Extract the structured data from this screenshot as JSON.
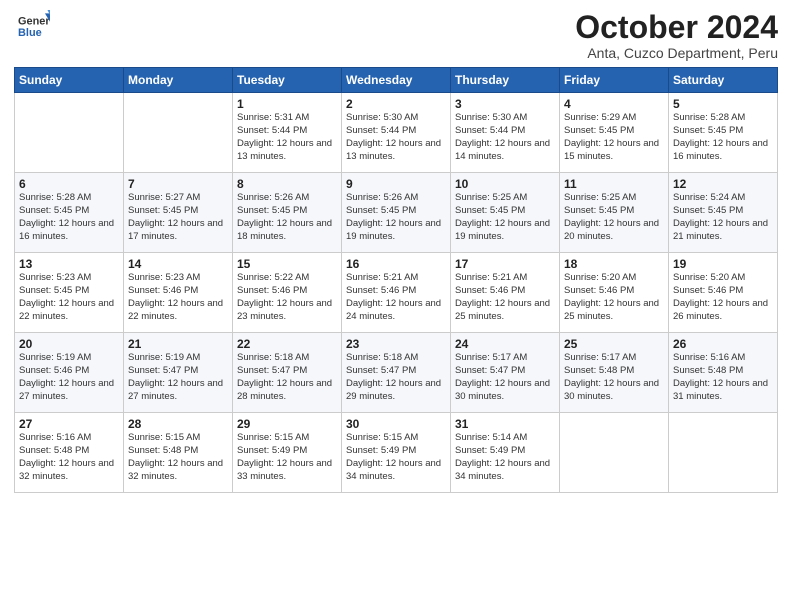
{
  "logo": {
    "general": "General",
    "blue": "Blue"
  },
  "header": {
    "month": "October 2024",
    "location": "Anta, Cuzco Department, Peru"
  },
  "days_of_week": [
    "Sunday",
    "Monday",
    "Tuesday",
    "Wednesday",
    "Thursday",
    "Friday",
    "Saturday"
  ],
  "weeks": [
    [
      {
        "day": "",
        "sunrise": "",
        "sunset": "",
        "daylight": ""
      },
      {
        "day": "",
        "sunrise": "",
        "sunset": "",
        "daylight": ""
      },
      {
        "day": "1",
        "sunrise": "Sunrise: 5:31 AM",
        "sunset": "Sunset: 5:44 PM",
        "daylight": "Daylight: 12 hours and 13 minutes."
      },
      {
        "day": "2",
        "sunrise": "Sunrise: 5:30 AM",
        "sunset": "Sunset: 5:44 PM",
        "daylight": "Daylight: 12 hours and 13 minutes."
      },
      {
        "day": "3",
        "sunrise": "Sunrise: 5:30 AM",
        "sunset": "Sunset: 5:44 PM",
        "daylight": "Daylight: 12 hours and 14 minutes."
      },
      {
        "day": "4",
        "sunrise": "Sunrise: 5:29 AM",
        "sunset": "Sunset: 5:45 PM",
        "daylight": "Daylight: 12 hours and 15 minutes."
      },
      {
        "day": "5",
        "sunrise": "Sunrise: 5:28 AM",
        "sunset": "Sunset: 5:45 PM",
        "daylight": "Daylight: 12 hours and 16 minutes."
      }
    ],
    [
      {
        "day": "6",
        "sunrise": "Sunrise: 5:28 AM",
        "sunset": "Sunset: 5:45 PM",
        "daylight": "Daylight: 12 hours and 16 minutes."
      },
      {
        "day": "7",
        "sunrise": "Sunrise: 5:27 AM",
        "sunset": "Sunset: 5:45 PM",
        "daylight": "Daylight: 12 hours and 17 minutes."
      },
      {
        "day": "8",
        "sunrise": "Sunrise: 5:26 AM",
        "sunset": "Sunset: 5:45 PM",
        "daylight": "Daylight: 12 hours and 18 minutes."
      },
      {
        "day": "9",
        "sunrise": "Sunrise: 5:26 AM",
        "sunset": "Sunset: 5:45 PM",
        "daylight": "Daylight: 12 hours and 19 minutes."
      },
      {
        "day": "10",
        "sunrise": "Sunrise: 5:25 AM",
        "sunset": "Sunset: 5:45 PM",
        "daylight": "Daylight: 12 hours and 19 minutes."
      },
      {
        "day": "11",
        "sunrise": "Sunrise: 5:25 AM",
        "sunset": "Sunset: 5:45 PM",
        "daylight": "Daylight: 12 hours and 20 minutes."
      },
      {
        "day": "12",
        "sunrise": "Sunrise: 5:24 AM",
        "sunset": "Sunset: 5:45 PM",
        "daylight": "Daylight: 12 hours and 21 minutes."
      }
    ],
    [
      {
        "day": "13",
        "sunrise": "Sunrise: 5:23 AM",
        "sunset": "Sunset: 5:45 PM",
        "daylight": "Daylight: 12 hours and 22 minutes."
      },
      {
        "day": "14",
        "sunrise": "Sunrise: 5:23 AM",
        "sunset": "Sunset: 5:46 PM",
        "daylight": "Daylight: 12 hours and 22 minutes."
      },
      {
        "day": "15",
        "sunrise": "Sunrise: 5:22 AM",
        "sunset": "Sunset: 5:46 PM",
        "daylight": "Daylight: 12 hours and 23 minutes."
      },
      {
        "day": "16",
        "sunrise": "Sunrise: 5:21 AM",
        "sunset": "Sunset: 5:46 PM",
        "daylight": "Daylight: 12 hours and 24 minutes."
      },
      {
        "day": "17",
        "sunrise": "Sunrise: 5:21 AM",
        "sunset": "Sunset: 5:46 PM",
        "daylight": "Daylight: 12 hours and 25 minutes."
      },
      {
        "day": "18",
        "sunrise": "Sunrise: 5:20 AM",
        "sunset": "Sunset: 5:46 PM",
        "daylight": "Daylight: 12 hours and 25 minutes."
      },
      {
        "day": "19",
        "sunrise": "Sunrise: 5:20 AM",
        "sunset": "Sunset: 5:46 PM",
        "daylight": "Daylight: 12 hours and 26 minutes."
      }
    ],
    [
      {
        "day": "20",
        "sunrise": "Sunrise: 5:19 AM",
        "sunset": "Sunset: 5:46 PM",
        "daylight": "Daylight: 12 hours and 27 minutes."
      },
      {
        "day": "21",
        "sunrise": "Sunrise: 5:19 AM",
        "sunset": "Sunset: 5:47 PM",
        "daylight": "Daylight: 12 hours and 27 minutes."
      },
      {
        "day": "22",
        "sunrise": "Sunrise: 5:18 AM",
        "sunset": "Sunset: 5:47 PM",
        "daylight": "Daylight: 12 hours and 28 minutes."
      },
      {
        "day": "23",
        "sunrise": "Sunrise: 5:18 AM",
        "sunset": "Sunset: 5:47 PM",
        "daylight": "Daylight: 12 hours and 29 minutes."
      },
      {
        "day": "24",
        "sunrise": "Sunrise: 5:17 AM",
        "sunset": "Sunset: 5:47 PM",
        "daylight": "Daylight: 12 hours and 30 minutes."
      },
      {
        "day": "25",
        "sunrise": "Sunrise: 5:17 AM",
        "sunset": "Sunset: 5:48 PM",
        "daylight": "Daylight: 12 hours and 30 minutes."
      },
      {
        "day": "26",
        "sunrise": "Sunrise: 5:16 AM",
        "sunset": "Sunset: 5:48 PM",
        "daylight": "Daylight: 12 hours and 31 minutes."
      }
    ],
    [
      {
        "day": "27",
        "sunrise": "Sunrise: 5:16 AM",
        "sunset": "Sunset: 5:48 PM",
        "daylight": "Daylight: 12 hours and 32 minutes."
      },
      {
        "day": "28",
        "sunrise": "Sunrise: 5:15 AM",
        "sunset": "Sunset: 5:48 PM",
        "daylight": "Daylight: 12 hours and 32 minutes."
      },
      {
        "day": "29",
        "sunrise": "Sunrise: 5:15 AM",
        "sunset": "Sunset: 5:49 PM",
        "daylight": "Daylight: 12 hours and 33 minutes."
      },
      {
        "day": "30",
        "sunrise": "Sunrise: 5:15 AM",
        "sunset": "Sunset: 5:49 PM",
        "daylight": "Daylight: 12 hours and 34 minutes."
      },
      {
        "day": "31",
        "sunrise": "Sunrise: 5:14 AM",
        "sunset": "Sunset: 5:49 PM",
        "daylight": "Daylight: 12 hours and 34 minutes."
      },
      {
        "day": "",
        "sunrise": "",
        "sunset": "",
        "daylight": ""
      },
      {
        "day": "",
        "sunrise": "",
        "sunset": "",
        "daylight": ""
      }
    ]
  ]
}
